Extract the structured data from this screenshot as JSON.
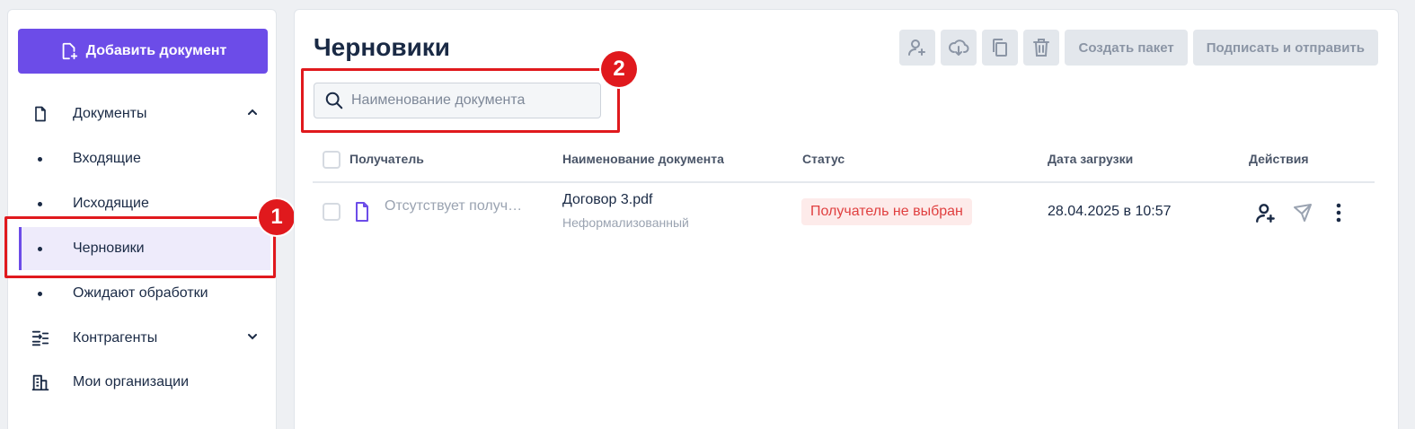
{
  "sidebar": {
    "add_button_label": "Добавить документ",
    "items": [
      {
        "label": "Документы",
        "icon": "document-icon"
      },
      {
        "label": "Входящие"
      },
      {
        "label": "Исходящие"
      },
      {
        "label": "Черновики"
      },
      {
        "label": "Ожидают обработки"
      },
      {
        "label": "Контрагенты",
        "icon": "counterparties-icon"
      },
      {
        "label": "Мои организации",
        "icon": "building-icon"
      }
    ]
  },
  "annotations": {
    "first": "1",
    "second": "2"
  },
  "main": {
    "title": "Черновики",
    "toolbar": {
      "create_package": "Создать пакет",
      "sign_and_send": "Подписать и отправить"
    },
    "search": {
      "placeholder": "Наименование документа",
      "value": ""
    },
    "table": {
      "headers": [
        "Получатель",
        "Наименование документа",
        "Статус",
        "Дата загрузки",
        "Действия"
      ],
      "rows": [
        {
          "recipient": "Отсутствует получ…",
          "doc_name": "Договор 3.pdf",
          "doc_type": "Неформализованный",
          "status": "Получатель не выбран",
          "date": "28.04.2025 в 10:57"
        }
      ]
    }
  },
  "colors": {
    "accent": "#6c4ce8",
    "highlight": "#e0191d",
    "status_bg": "#fdebea",
    "status_text": "#e04040"
  }
}
